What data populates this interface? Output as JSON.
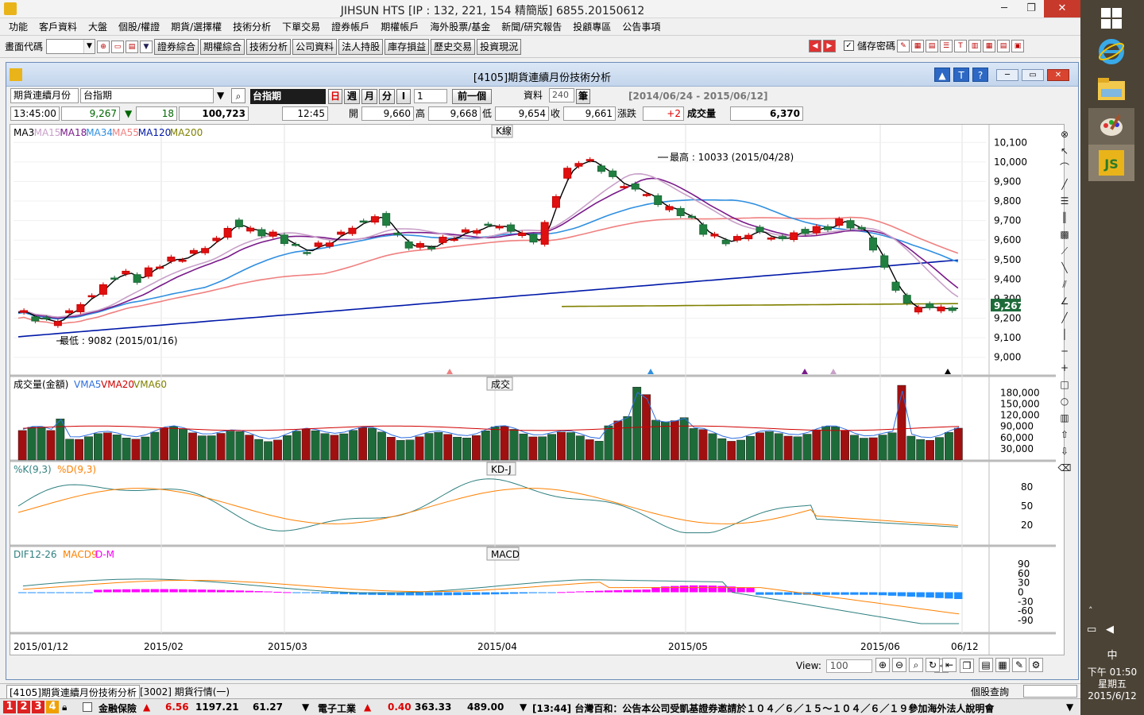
{
  "window": {
    "title": "JIHSUN HTS      [IP : 132, 221, 154 精簡版] 6855.20150612",
    "min": "─",
    "max": "❐",
    "close": "✕"
  },
  "menu": [
    "功能",
    "客戶資料",
    "大盤",
    "個股/權證",
    "期貨/選擇權",
    "技術分析",
    "下單交易",
    "證券帳戶",
    "期權帳戶",
    "海外股票/基金",
    "新聞/研究報告",
    "投顧專區",
    "公告事項"
  ],
  "toolbar": {
    "code_label": "畫面代碼",
    "buttons": [
      "證券綜合",
      "期權綜合",
      "技術分析",
      "公司資料",
      "法人持股",
      "庫存損益",
      "歷史交易",
      "投資現況"
    ],
    "save_password": "儲存密碼"
  },
  "child": {
    "title": "[4105]期貨連續月份技術分析",
    "series_select": "期貨連續月份",
    "symbol": "台指期",
    "symbol_dark": "台指期",
    "periods": [
      "日",
      "週",
      "月",
      "分",
      "I"
    ],
    "period_value": "1",
    "prev_button": "前一個",
    "data_label": "資料",
    "data_count": "240",
    "data_unit": "筆",
    "date_range": "[2014/06/24 - 2015/06/12]",
    "quote": {
      "time": "13:45:00",
      "price": "9,267",
      "change": "18",
      "amount": "100,723",
      "clock": "12:45",
      "open_label": "開",
      "open": "9,660",
      "high_label": "高",
      "high": "9,668",
      "low_label": "低",
      "low": "9,654",
      "close_label": "收",
      "close": "9,661",
      "chg_label": "漲跌",
      "chg": "+2",
      "vol_label": "成交量",
      "vol": "6,370"
    },
    "view_label": "View:",
    "view_value": "100"
  },
  "chart_data": [
    {
      "type": "candlestick",
      "panel": "K線",
      "legend": [
        {
          "name": "MA3",
          "color": "#000000"
        },
        {
          "name": "MA15",
          "color": "#c8a0c8"
        },
        {
          "name": "MA18",
          "color": "#7a1a8a"
        },
        {
          "name": "MA34",
          "color": "#2f8fe0"
        },
        {
          "name": "MA55",
          "color": "#f08080"
        },
        {
          "name": "MA120",
          "color": "#0018a8"
        },
        {
          "name": "MA200",
          "color": "#808000"
        }
      ],
      "y_ticks": [
        "10,100",
        "10,000",
        "9,900",
        "9,800",
        "9,700",
        "9,600",
        "9,500",
        "9,400",
        "9,300",
        "9,200",
        "9,100",
        "9,000"
      ],
      "ylim": [
        8950,
        10150
      ],
      "last_price": "9,267",
      "annotations": {
        "high": "最高 : 10033 (2015/04/28)",
        "low": "最低 : 9082 (2015/01/16)"
      },
      "x_labels": [
        "2015/01/12",
        "2015/02",
        "2015/03",
        "2015/04",
        "2015/05",
        "2015/06",
        "06/12"
      ]
    },
    {
      "type": "bar",
      "panel": "成交",
      "title": "成交量(金額)",
      "legend": [
        {
          "name": "VMA5",
          "color": "#2f6fe0"
        },
        {
          "name": "VMA20",
          "color": "#d00000"
        },
        {
          "name": "VMA60",
          "color": "#808000"
        }
      ],
      "y_ticks": [
        "180,000",
        "150,000",
        "120,000",
        "90,000",
        "60,000",
        "30,000"
      ],
      "ylim": [
        0,
        200000
      ]
    },
    {
      "type": "line",
      "panel": "KD-J",
      "legend": [
        {
          "name": "%K(9,3)",
          "color": "#2f7f7f"
        },
        {
          "name": "%D(9,3)",
          "color": "#ff8000"
        }
      ],
      "y_ticks": [
        "80",
        "50",
        "20"
      ],
      "ylim": [
        0,
        100
      ]
    },
    {
      "type": "bar",
      "panel": "MACD",
      "legend": [
        {
          "name": "DIF12-26",
          "color": "#2f7f7f"
        },
        {
          "name": "MACD9",
          "color": "#ff8000"
        },
        {
          "name": "D-M",
          "color": "#ff00ff"
        }
      ],
      "y_ticks": [
        "90",
        "60",
        "30",
        "0",
        "-30",
        "-60",
        "-90"
      ],
      "ylim": [
        -110,
        110
      ]
    }
  ],
  "tabs": [
    "[4105]期貨連續月份技術分析",
    "[3002] 期貨行情(一)"
  ],
  "stock_query": "個股查詢",
  "ticker": {
    "nums": [
      "1",
      "2",
      "3",
      "4"
    ],
    "i1_name": "金融保險",
    "i1_chg": "6.56",
    "i1_val": "1197.21",
    "i1_vol": "61.27",
    "i2_name": "電子工業",
    "i2_chg": "0.40",
    "i2_val": "363.33",
    "i2_vol": "489.00",
    "news": "[13:44] 台灣百和：公告本公司受凱基證券邀請於１０４／６／１５～１０４／６／１９參加海外法人說明會"
  },
  "clock": {
    "time": "下午 01:50",
    "day": "星期五",
    "date": "2015/6/12",
    "ime": "中"
  }
}
